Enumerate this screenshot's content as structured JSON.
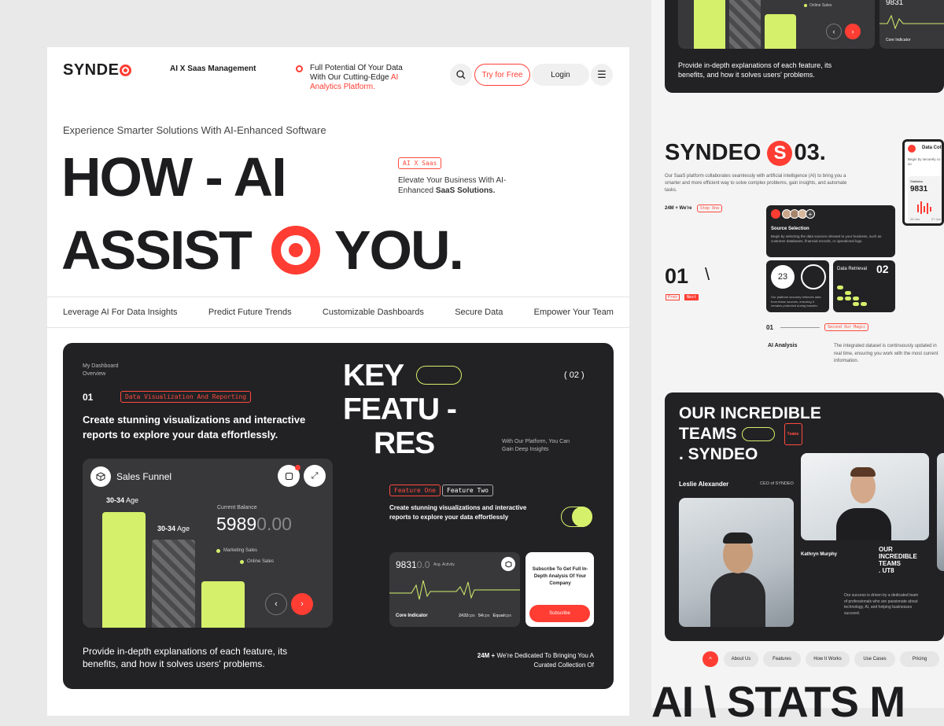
{
  "header": {
    "logo": "SYNDE",
    "tagline": "AI X Saas Management",
    "promo_line1": "Full Potential Of Your Data",
    "promo_line2": "With Our Cutting-Edge",
    "promo_accent": "AI Analytics Platform.",
    "try_label": "Try for Free",
    "login_label": "Login"
  },
  "hero": {
    "subtitle": "Experience Smarter Solutions With AI-Enhanced Software",
    "line1": "HOW - AI",
    "line2a": "ASSIST",
    "line2b": "YOU.",
    "tag": "AI X Saas",
    "desc1": "Elevate Your Business With AI-",
    "desc2": "Enhanced",
    "desc3": "SaaS Solutions."
  },
  "nav": [
    "Leverage AI For Data Insights",
    "Predict Future Trends",
    "Customizable Dashboards",
    "Secure Data",
    "Empower Your Team"
  ],
  "dashboard": {
    "crumb1": "My Dashboard",
    "crumb2": "Overview",
    "step": "01",
    "step_tag": "Data Visualization And Reporting",
    "heading": "Create stunning visualizations and interactive reports to explore your data effortlessly.",
    "widget_title": "Sales Funnel",
    "bar1_label": "30-34",
    "bar2_label": "30-34",
    "age": "Age",
    "balance_label": "Current Balance",
    "balance_main": "5989",
    "balance_dim": "0.00",
    "legend1": "Marketing Sales",
    "legend2": "Online Sales",
    "bottom_text": "Provide in-depth explanations of each feature, its benefits, and how it solves users' problems.",
    "key1": "KEY",
    "key2": "FEATU -",
    "key3": "RES",
    "num": "( 02 )",
    "platform1": "With Our Platform, You Can",
    "platform2": "Gain Deep Insights",
    "feature_one": "Feature One",
    "feature_two": "Feature Two",
    "feature_text": "Create stunning visualizations and interactive reports to explore your data effortlessly",
    "activity_main": "9831",
    "activity_dim": "0.0",
    "activity_label": "Avg. Activity",
    "core": "Core Indicator",
    "m1": "2432",
    "m1u": "cps",
    "m2": "54",
    "m2u": "cps",
    "m3": "Equal",
    "m3u": "cps",
    "subscribe_text": "Subscribe To Get Full In-Depth Analysis Of Your Company",
    "subscribe_btn": "Subscribe",
    "stat_bold": "24M +",
    "stat_text1": "We're Dedicated To Bringing You A",
    "stat_text2": "Curated Collection Of"
  },
  "right": {
    "top_text": "Provide in-depth explanations of each feature, its benefits, and how it solves users' problems.",
    "top_label": "Online Sales",
    "top_num": "9831",
    "top_core": "Core Indicator",
    "s03_a": "SYNDEO",
    "s03_b": "S",
    "s03_c": "03.",
    "s03_desc": "Our SaaS platform collaborates seamlessly with artificial intelligence (AI) to bring you a smarter and more efficient way to solve complex problems, gain insights, and automate tasks.",
    "s03_stat": "24M + We're",
    "step_one": "Step One",
    "source_title": "Source Selection",
    "source_desc": "Begin by selecting the data sources relevant to your business, such as customer databases, financial records, or operational logs.",
    "data_coll": "Data Coll",
    "data_coll_desc": "Begin by securely co data from multiple so",
    "statistics": "Statistics",
    "stat_num": "9831",
    "d1": "26 Jan",
    "d2": "27 Jan",
    "big01": "01",
    "slash": "\\",
    "prev": "Prev",
    "next": "Next",
    "c23": "23",
    "c23_desc": "Our platform securely retrieves data from these sources, ensuring it remains protected during transfer.",
    "retrieval": "Data Retrieval",
    "n02": "02",
    "small01": "01",
    "second_magic": "Second Our Magic",
    "ai_analysis": "AI Analysis",
    "ai_desc": "The integrated dataset is continuously updated in real time, ensuring you work with the most current information.",
    "teams1": "OUR INCREDIBLE",
    "teams2": "TEAMS",
    "teams3": ". SYNDEO",
    "teams_tag": "Teams",
    "person1": "Leslie Alexander",
    "role1": "CEO of SYNDEO",
    "person2": "Kathryn Murphy",
    "mini1": "OUR",
    "mini2": "INCREDIBLE",
    "mini3": "TEAMS",
    "mini4": ". UT8",
    "team_desc": "Our success is driven by a dedicated team of professionals who are passionate about technology, AI, and helping businesses succeed.",
    "foot_nav": [
      "About Us",
      "Features",
      "How It Works",
      "Use Cases",
      "Pricing"
    ],
    "big_bottom": "AI \\ STATS M"
  },
  "colors": {
    "accent": "#ff3d33",
    "lime": "#d5f06b",
    "dark": "#222225"
  }
}
